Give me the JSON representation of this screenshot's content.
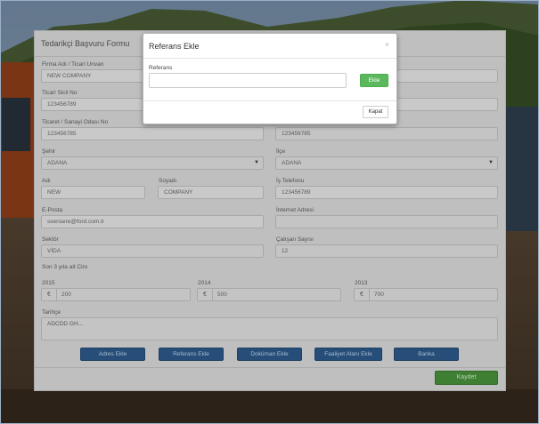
{
  "form": {
    "title": "Tedarikçi Başvuru Formu",
    "fields": {
      "firma_adi": {
        "label": "Firma Adı / Ticari Unvan",
        "value": "NEW COMPANY"
      },
      "ticari_sicil": {
        "label": "Ticari Sicil No",
        "value": "123456789"
      },
      "oda_no": {
        "label": "Ticaret / Sanayi Odası No",
        "value": "123456785"
      },
      "right_col_value": {
        "value": "123456785"
      },
      "sehir": {
        "label": "Şehir",
        "value": "ADANA"
      },
      "ilce": {
        "label": "İlçe",
        "value": "ADANA"
      },
      "adi": {
        "label": "Adı",
        "value": "NEW"
      },
      "soyadi": {
        "label": "Soyadı",
        "value": "COMPANY"
      },
      "is_telefonu": {
        "label": "İş Telefonu",
        "value": "123456789"
      },
      "eposta": {
        "label": "E-Posta",
        "value": "ssensere@ford.com.tr"
      },
      "internet_adresi": {
        "label": "İnternet Adresi",
        "value": ""
      },
      "sektor": {
        "label": "Sektör",
        "value": "VİDA"
      },
      "calisan_sayisi": {
        "label": "Çalışan Sayısı",
        "value": "12"
      },
      "ciro_heading": {
        "label": "Son 3 yıla ait Ciro"
      },
      "ciro_2015": {
        "label": "2015",
        "currency": "€",
        "value": "200"
      },
      "ciro_2014": {
        "label": "2014",
        "currency": "€",
        "value": "500"
      },
      "ciro_2013": {
        "label": "2013",
        "currency": "€",
        "value": "700"
      },
      "tarihce": {
        "label": "Tarihçe",
        "value": "ADCDD GH..."
      }
    },
    "buttons": {
      "adres_ekle": "Adres Ekle",
      "referans_ekle": "Referans Ekle",
      "dokuman_ekle": "Doküman Ekle",
      "faaliyet_alani_ekle": "Faaliyet Alanı Ekle",
      "banka": "Banka",
      "kaydet": "Kaydet"
    }
  },
  "modal": {
    "title": "Referans Ekle",
    "close_symbol": "×",
    "field_label": "Referans",
    "field_value": "",
    "add_button": "Ekle",
    "close_button": "Kapat"
  },
  "colors": {
    "primary_button": "#274e78",
    "save_button": "#3f7f33",
    "add_button": "#5cb85c"
  }
}
